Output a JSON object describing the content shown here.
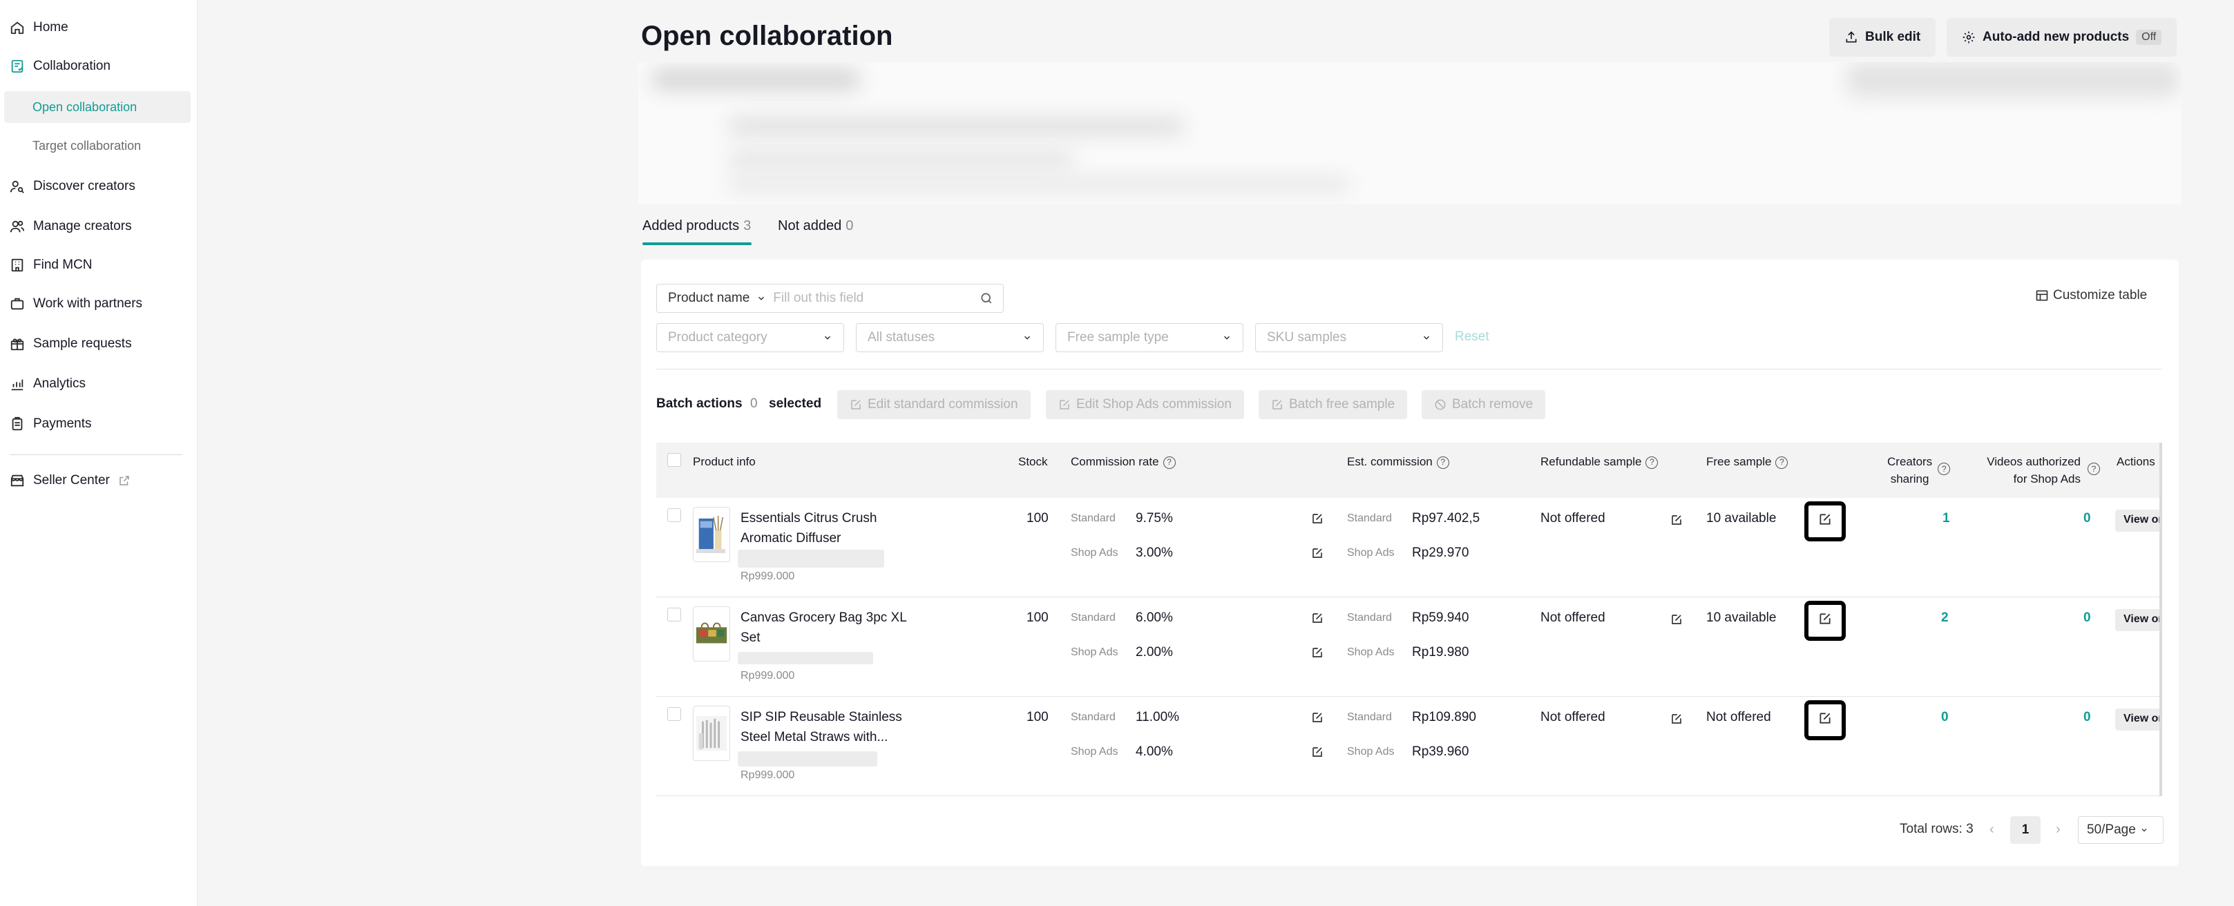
{
  "sidebar": {
    "items": [
      {
        "label": "Home",
        "icon": "home-icon"
      },
      {
        "label": "Collaboration",
        "icon": "collaboration-icon"
      },
      {
        "label": "Open collaboration"
      },
      {
        "label": "Target collaboration"
      },
      {
        "label": "Discover creators",
        "icon": "person-search-icon"
      },
      {
        "label": "Manage creators",
        "icon": "people-icon"
      },
      {
        "label": "Find MCN",
        "icon": "building-icon"
      },
      {
        "label": "Work with partners",
        "icon": "handshake-icon"
      },
      {
        "label": "Sample requests",
        "icon": "gift-icon"
      },
      {
        "label": "Analytics",
        "icon": "chart-icon"
      },
      {
        "label": "Payments",
        "icon": "clipboard-icon"
      },
      {
        "label": "Seller Center",
        "icon": "store-icon"
      }
    ]
  },
  "header": {
    "title": "Open collaboration",
    "bulk_edit": "Bulk edit",
    "auto_add": "Auto-add new products",
    "auto_add_status": "Off"
  },
  "tabs": [
    {
      "label": "Added products",
      "count": "3"
    },
    {
      "label": "Not added",
      "count": "0"
    }
  ],
  "filters": {
    "search_type": "Product name",
    "search_placeholder": "Fill out this field",
    "category": "Product category",
    "status": "All statuses",
    "free_sample_type": "Free sample type",
    "sku_samples": "SKU samples",
    "reset": "Reset",
    "customize": "Customize table"
  },
  "batch": {
    "label": "Batch actions",
    "count": "0",
    "selected": "selected",
    "edit_standard": "Edit standard commission",
    "edit_shop_ads": "Edit Shop Ads commission",
    "batch_free_sample": "Batch free sample",
    "batch_remove": "Batch remove"
  },
  "table": {
    "headers": {
      "product_info": "Product info",
      "stock": "Stock",
      "commission_rate": "Commission rate",
      "est_commission": "Est. commission",
      "refundable_sample": "Refundable sample",
      "free_sample": "Free sample",
      "creators_sharing_1": "Creators",
      "creators_sharing_2": "sharing",
      "videos_authorized_1": "Videos authorized",
      "videos_authorized_2": "for Shop Ads",
      "actions": "Actions"
    },
    "standard_label": "Standard",
    "shop_ads_label": "Shop Ads",
    "view_label": "View or",
    "rows": [
      {
        "name": "Essentials Citrus Crush Aromatic Diffuser",
        "price": "Rp999.000",
        "stock": "100",
        "std_rate": "9.75%",
        "ads_rate": "3.00%",
        "std_comm": "Rp97.402,5",
        "ads_comm": "Rp29.970",
        "refundable": "Not offered",
        "free_sample": "10 available",
        "creators": "1",
        "videos": "0"
      },
      {
        "name": "Canvas Grocery Bag 3pc XL Set",
        "price": "Rp999.000",
        "stock": "100",
        "std_rate": "6.00%",
        "ads_rate": "2.00%",
        "std_comm": "Rp59.940",
        "ads_comm": "Rp19.980",
        "refundable": "Not offered",
        "free_sample": "10 available",
        "creators": "2",
        "videos": "0"
      },
      {
        "name": "SIP SIP Reusable Stainless Steel Metal Straws with...",
        "price": "Rp999.000",
        "stock": "100",
        "std_rate": "11.00%",
        "ads_rate": "4.00%",
        "std_comm": "Rp109.890",
        "ads_comm": "Rp39.960",
        "refundable": "Not offered",
        "free_sample": "Not offered",
        "creators": "0",
        "videos": "0"
      }
    ]
  },
  "pagination": {
    "total": "Total rows: 3",
    "current": "1",
    "page_size": "50/Page"
  },
  "colors": {
    "accent": "#0f9d94",
    "text": "#161823",
    "muted": "#8a8a8a"
  }
}
